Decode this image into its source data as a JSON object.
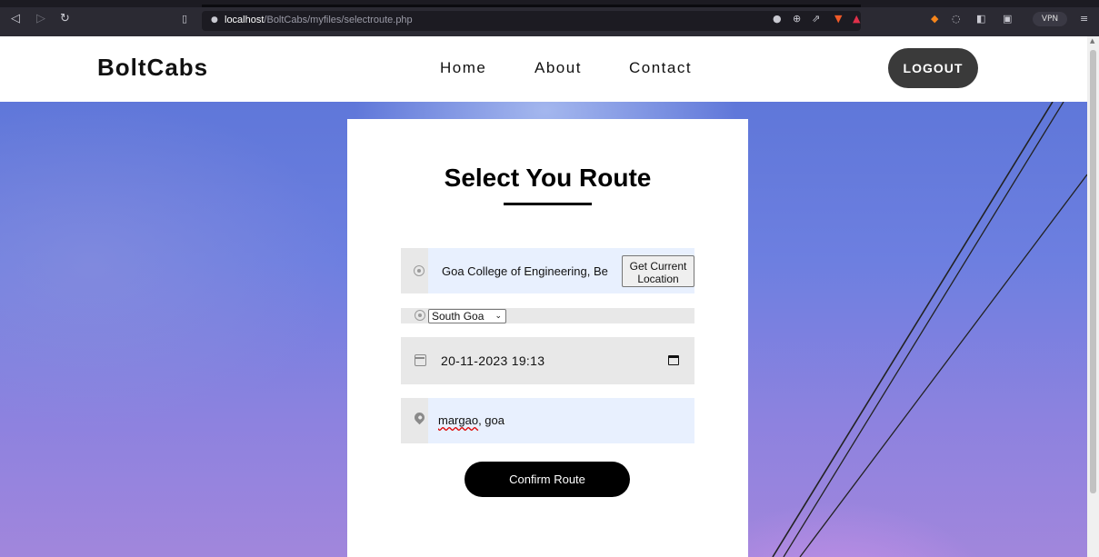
{
  "browser": {
    "url_host": "localhost",
    "url_path": "/BoltCabs/myfiles/selectroute.php",
    "vpn_label": "VPN",
    "icons": [
      "back-icon",
      "forward-icon",
      "reload-icon",
      "bookmark-icon",
      "site-info-icon",
      "location-icon",
      "zoom-icon",
      "share-icon",
      "brave-shields-icon",
      "rewards-icon",
      "metamask-icon",
      "extensions-icon",
      "sidebar-icon",
      "wallet-icon",
      "menu-icon"
    ]
  },
  "header": {
    "brand": "BoltCabs",
    "nav": [
      "Home",
      "About",
      "Contact"
    ],
    "logout_label": "LOGOUT"
  },
  "form": {
    "title": "Select You Route",
    "pickup_value": "Goa College of Engineering, Be",
    "get_location_label_line1": "Get Current",
    "get_location_label_line2": "Location",
    "district_selected": "South Goa",
    "datetime_value": "20-11-2023 19:13",
    "destination_word1": "margao",
    "destination_rest": ", goa",
    "confirm_label": "Confirm Route"
  },
  "colors": {
    "header_bg": "#ffffff",
    "logout_bg": "#3a3a3a",
    "confirm_bg": "#000000",
    "autofill_bg": "#e8f0fe",
    "field_bg": "#e8e8e8"
  }
}
